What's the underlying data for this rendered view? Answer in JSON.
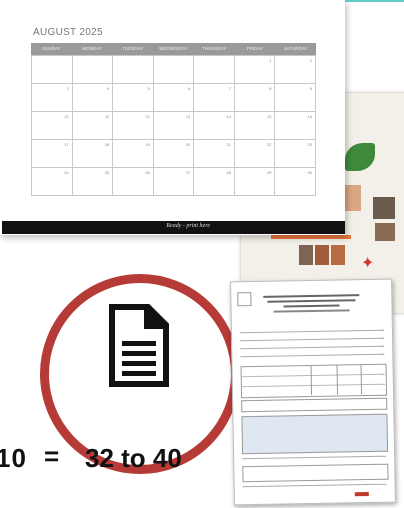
{
  "calendar": {
    "title": "AUGUST 2025",
    "weekdays": [
      "SUNDAY",
      "MONDAY",
      "TUESDAY",
      "WEDNESDAY",
      "THURSDAY",
      "FRIDAY",
      "SATURDAY"
    ],
    "days": [
      "",
      "",
      "",
      "",
      "",
      "1",
      "2",
      "3",
      "4",
      "5",
      "6",
      "7",
      "8",
      "9",
      "10",
      "11",
      "12",
      "13",
      "14",
      "15",
      "16",
      "17",
      "18",
      "19",
      "20",
      "21",
      "22",
      "23",
      "24",
      "25",
      "26",
      "27",
      "28",
      "29",
      "30"
    ],
    "footer": "Ready - print here"
  },
  "equation": {
    "left": "10",
    "sign": "=",
    "right": "32 to 40"
  },
  "icons": {
    "document": "document-icon"
  },
  "colors": {
    "circle": "#b63a36",
    "accent_teal": "#5fcfc6",
    "text": "#111111"
  }
}
